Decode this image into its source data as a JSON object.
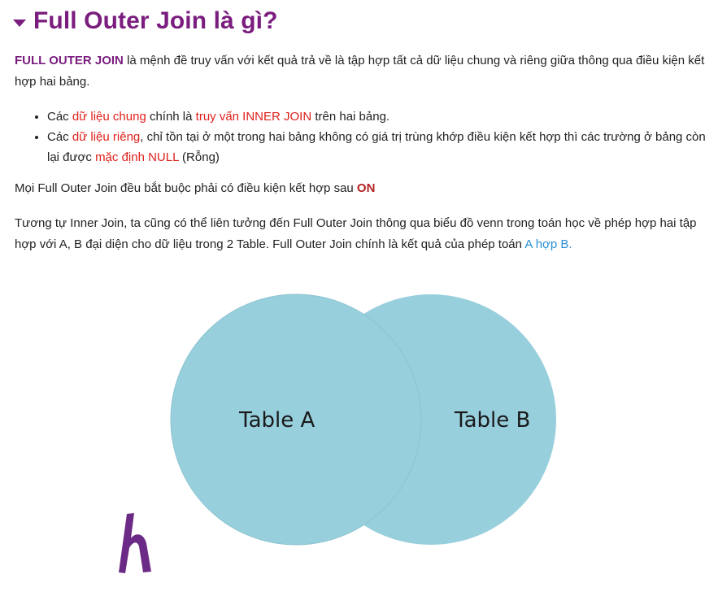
{
  "heading": {
    "title": "Full Outer Join là gì?"
  },
  "intro": {
    "term": "FULL OUTER JOIN",
    "rest": " là mệnh đề truy vấn với kết quả trả về là tập hợp tất cả dữ liệu chung và riêng giữa thông qua điều kiện kết hợp hai bảng."
  },
  "bullets": [
    {
      "t1": "Các ",
      "r1": "dữ liệu chung",
      "t2": " chính là ",
      "r2": "truy vấn INNER JOIN",
      "t3": " trên hai bảng."
    },
    {
      "t1": "Các ",
      "r1": "dữ liệu riêng",
      "t2": ", chỉ tồn tại ở một trong hai bảng không có giá trị trùng khớp điều kiện kết hợp thì các trường ở bảng còn lại được ",
      "r2": "mặc định NULL",
      "t3": " (Rỗng)"
    }
  ],
  "condition": {
    "text": "Mọi Full Outer Join đều bắt buộc phải có điều kiện kết hợp sau ",
    "keyword": "ON"
  },
  "analogy": {
    "text": "Tương tự Inner Join, ta cũng có thể liên tưởng đến Full Outer Join thông qua biểu đồ venn trong toán học về phép hợp hai tập hợp với A, B đại diện cho dữ liệu trong 2 Table. Full Outer Join chính là kết quả của phép toán ",
    "link": "A hợp B."
  },
  "venn": {
    "label_a": "Table A",
    "label_b": "Table B",
    "fill_color": "#98cfdd",
    "text_color": "#1a1a1a"
  },
  "logo": {
    "icon": "h-logo-icon",
    "color": "#6b2a86"
  },
  "colors": {
    "heading": "#7a1d7e",
    "highlight_red": "#e0201b",
    "keyword_red": "#b42222",
    "link_blue": "#2a8fd6"
  }
}
